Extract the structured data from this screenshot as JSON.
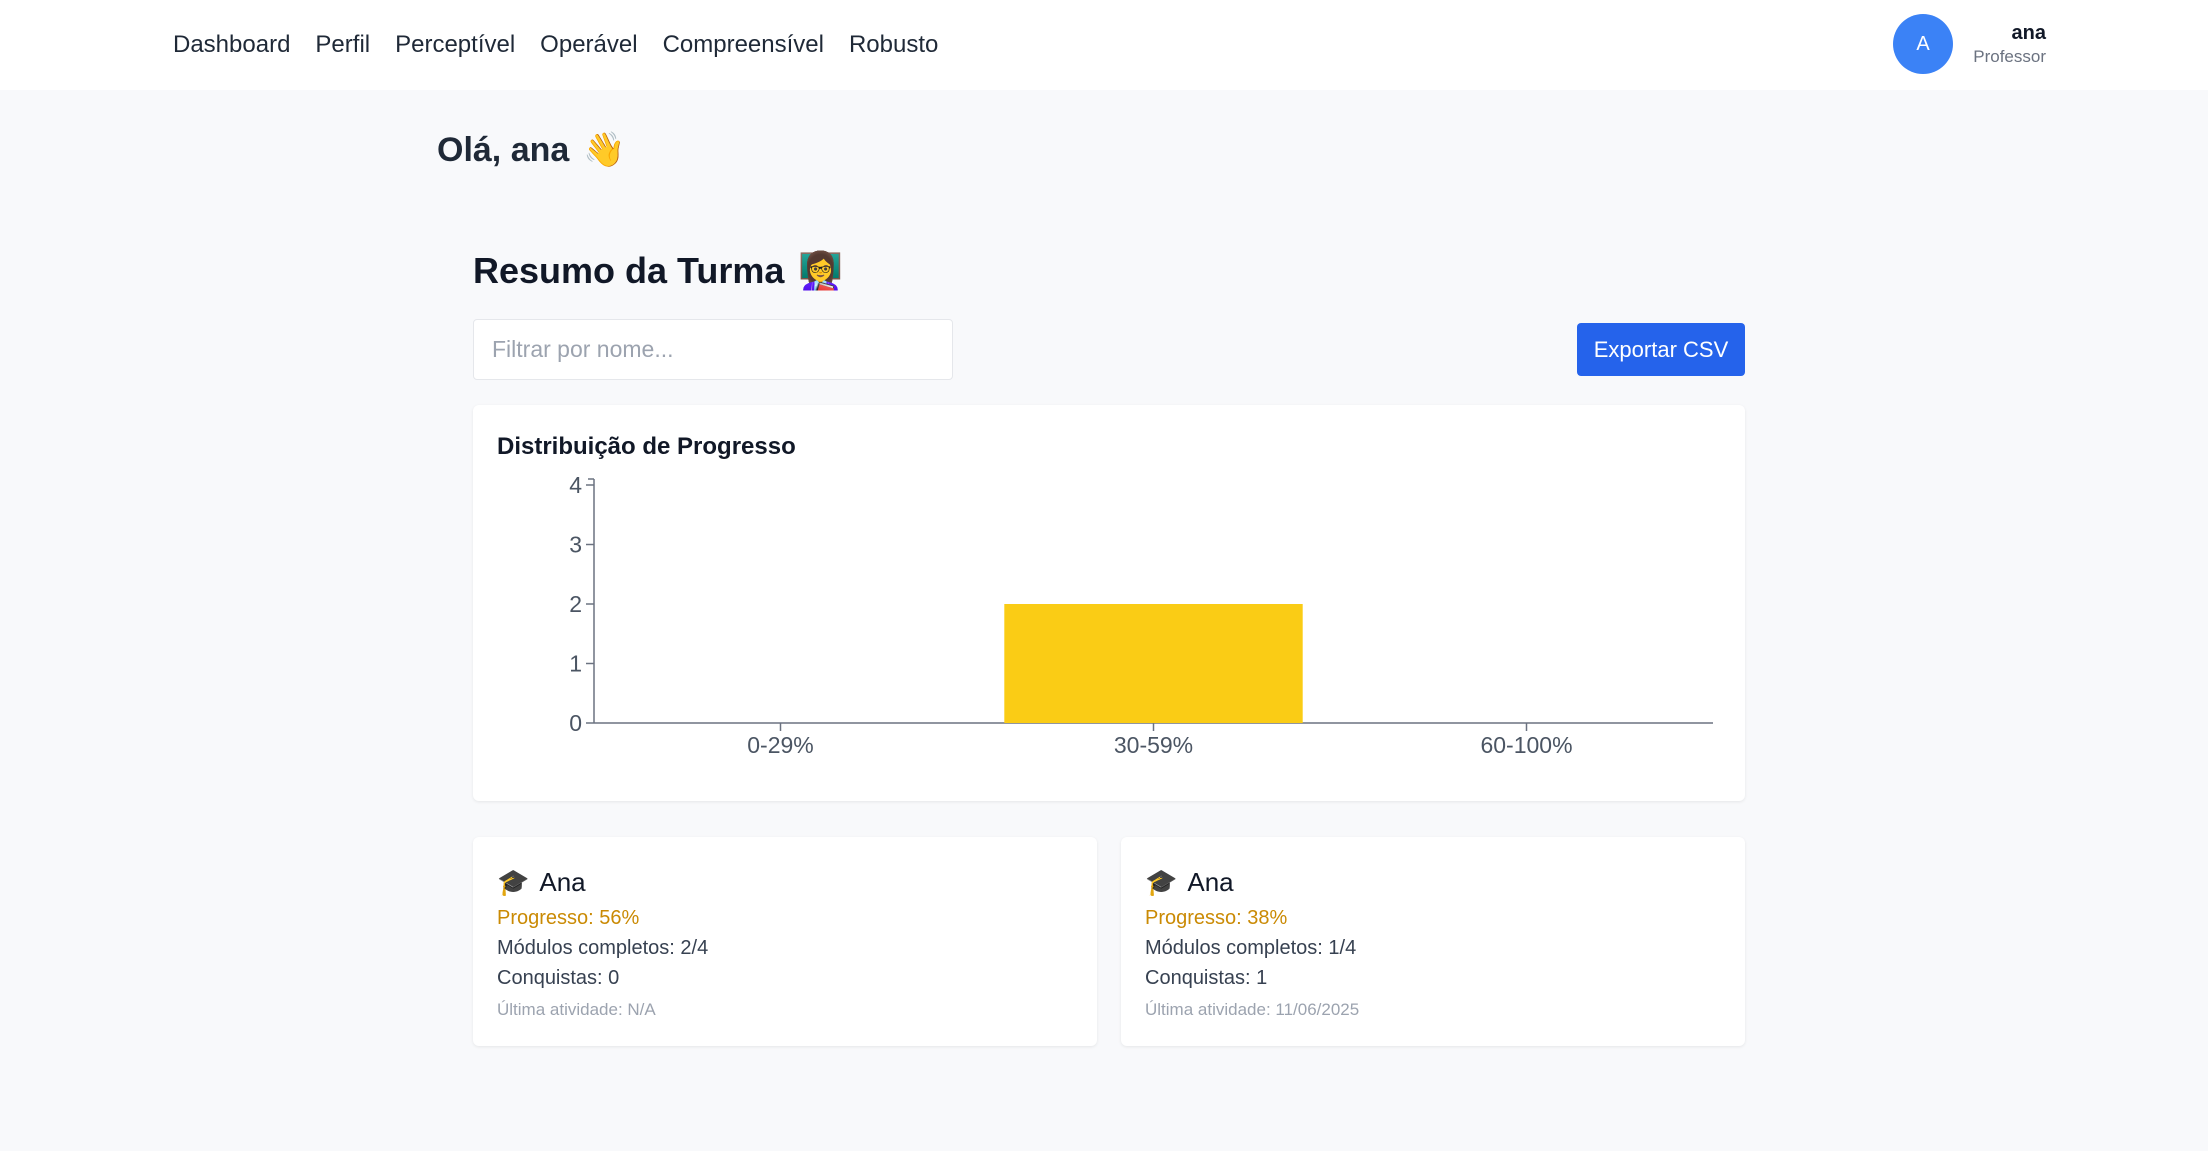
{
  "nav": {
    "items": [
      {
        "label": "Dashboard"
      },
      {
        "label": "Perfil"
      },
      {
        "label": "Perceptível"
      },
      {
        "label": "Operável"
      },
      {
        "label": "Compreensível"
      },
      {
        "label": "Robusto"
      }
    ]
  },
  "user": {
    "initial": "A",
    "name": "ana",
    "role": "Professor"
  },
  "greeting": {
    "text": "Olá, ana",
    "emoji": "👋"
  },
  "summary": {
    "title": "Resumo da Turma",
    "emoji": "👩‍🏫",
    "filter_placeholder": "Filtrar por nome...",
    "export_label": "Exportar CSV"
  },
  "chart_data": {
    "type": "bar",
    "title": "Distribuição de Progresso",
    "categories": [
      "0-29%",
      "30-59%",
      "60-100%"
    ],
    "values": [
      0,
      2,
      0
    ],
    "ylim": [
      0,
      4
    ],
    "yticks": [
      0,
      1,
      2,
      3,
      4
    ],
    "bar_color": "#facc15",
    "grid": false
  },
  "students": [
    {
      "icon": "🎓",
      "name": "Ana",
      "progress": "Progresso: 56%",
      "modules": "Módulos completos: 2/4",
      "achievements": "Conquistas: 0",
      "last_activity": "Última atividade: N/A"
    },
    {
      "icon": "🎓",
      "name": "Ana",
      "progress": "Progresso: 38%",
      "modules": "Módulos completos: 1/4",
      "achievements": "Conquistas: 1",
      "last_activity": "Última atividade: 11/06/2025"
    }
  ],
  "colors": {
    "accent": "#2563eb",
    "avatar": "#3b82f6",
    "progress_text": "#ca8a04"
  }
}
